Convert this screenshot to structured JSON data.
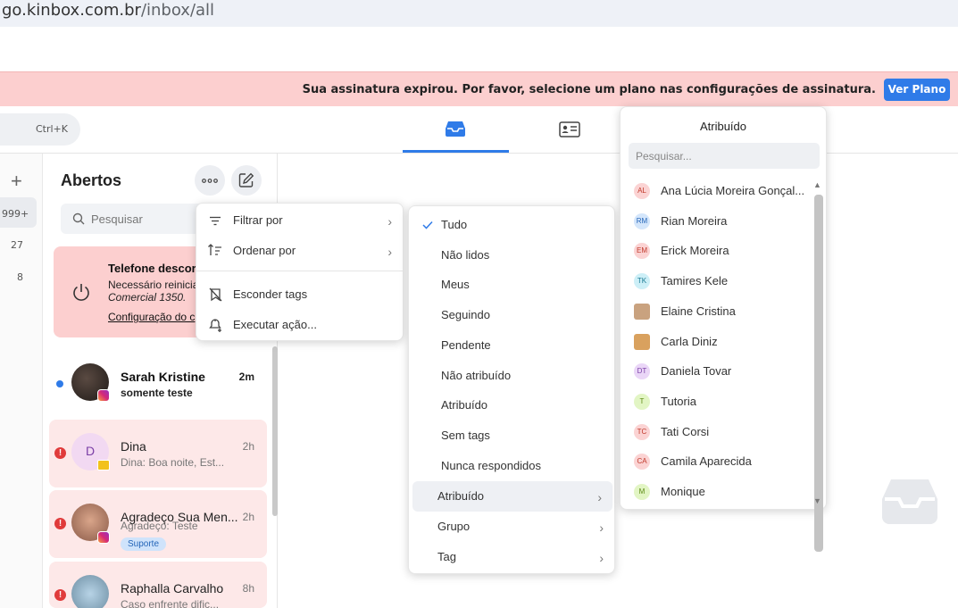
{
  "browser": {
    "url_main": "go.kinbox.com.br",
    "url_path": "/inbox/all"
  },
  "banner": {
    "message": "Sua assinatura expirou. Por favor, selecione um plano nas configurações de assinatura.",
    "button": "Ver Plano"
  },
  "topbar": {
    "shortcut": "Ctrl+K"
  },
  "rail": {
    "counts": [
      "999+",
      "27",
      "8"
    ]
  },
  "list": {
    "title": "Abertos",
    "search_placeholder": "Pesquisar",
    "alert": {
      "title": "Telefone descor",
      "line1": "Necessário reinicia",
      "line2": "Comercial 1350.",
      "link": "Configuração do c"
    },
    "conversations": [
      {
        "name": "Sarah Kristine",
        "preview": "somente teste",
        "time": "2m",
        "unread": true
      },
      {
        "name": "Dina",
        "preview": "Dina: Boa noite, Est...",
        "time": "2h",
        "avatar_initial": "D"
      },
      {
        "name": "Agradeço Sua Men...",
        "preview": "Agradeço: Teste",
        "time": "2h",
        "tag": "Suporte"
      },
      {
        "name": "Raphalla Carvalho",
        "preview": "Caso enfrente dific...",
        "time": "8h"
      }
    ]
  },
  "menu_main": {
    "items": [
      {
        "label": "Filtrar por"
      },
      {
        "label": "Ordenar por"
      },
      {
        "label": "Esconder tags"
      },
      {
        "label": "Executar ação..."
      }
    ]
  },
  "menu_filter": {
    "items": [
      {
        "label": "Tudo",
        "checked": true
      },
      {
        "label": "Não lidos"
      },
      {
        "label": "Meus"
      },
      {
        "label": "Seguindo"
      },
      {
        "label": "Pendente"
      },
      {
        "label": "Não atribuído"
      },
      {
        "label": "Atribuído"
      },
      {
        "label": "Sem tags"
      },
      {
        "label": "Nunca respondidos"
      },
      {
        "label": "Atribuído"
      },
      {
        "label": "Grupo"
      },
      {
        "label": "Tag"
      }
    ]
  },
  "assignee": {
    "title": "Atribuído",
    "search_placeholder": "Pesquisar...",
    "people": [
      {
        "initials": "AL",
        "name": "Ana Lúcia Moreira Gonçal...",
        "bg": "#fbd3d3",
        "fg": "#c0392b"
      },
      {
        "initials": "RM",
        "name": "Rian Moreira",
        "bg": "#d4e6fb",
        "fg": "#2465b8"
      },
      {
        "initials": "EM",
        "name": "Erick Moreira",
        "bg": "#fbd3d3",
        "fg": "#c0392b"
      },
      {
        "initials": "TK",
        "name": "Tamires Kele",
        "bg": "#cdeff7",
        "fg": "#1b7a93"
      },
      {
        "initials": "",
        "name": "Elaine Cristina",
        "bg": "#c9a27f",
        "fg": "#fff"
      },
      {
        "initials": "",
        "name": "Carla Diniz",
        "bg": "#d9a15e",
        "fg": "#fff"
      },
      {
        "initials": "DT",
        "name": "Daniela Tovar",
        "bg": "#ead6f7",
        "fg": "#7b3fa6"
      },
      {
        "initials": "T",
        "name": "Tutoria",
        "bg": "#e2f5c4",
        "fg": "#5b8a12"
      },
      {
        "initials": "TC",
        "name": "Tati Corsi",
        "bg": "#fbd3d3",
        "fg": "#c0392b"
      },
      {
        "initials": "CA",
        "name": "Camila Aparecida",
        "bg": "#fbd3d3",
        "fg": "#c0392b"
      },
      {
        "initials": "M",
        "name": "Monique",
        "bg": "#e2f5c4",
        "fg": "#5b8a12"
      }
    ]
  },
  "colors": {
    "accent": "#2f7be8",
    "banner_bg": "#fccfcf",
    "error": "#e03b3b"
  }
}
